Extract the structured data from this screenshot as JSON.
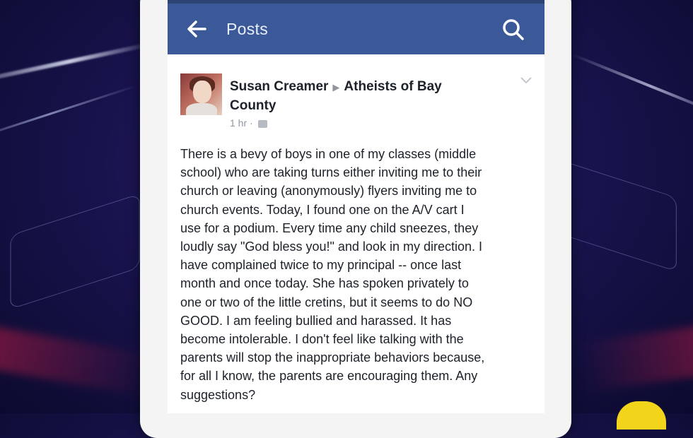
{
  "topbar": {
    "title": "Posts",
    "back_icon": "back-arrow-icon",
    "search_icon": "search-icon",
    "color": "#3b5998"
  },
  "post": {
    "author": "Susan Creamer",
    "group": "Atheists of Bay County",
    "timestamp": "1 hr",
    "privacy_icon": "audience-icon",
    "body": "There is a bevy of boys in one of my classes (middle\nschool) who are taking turns either inviting me to their\nchurch or leaving (anonymously) flyers inviting me to\nchurch events. Today, I found one on the A/V cart I\nuse for a podium. Every time any child sneezes, they\nloudly say \"God bless you!\" and look in my direction. I\nhave complained twice to my principal -- once last\nmonth and once today. She has spoken privately to\none or two of the little cretins, but it seems to do NO\nGOOD. I am feeling bullied and harassed. It has\nbecome intolerable. I don't feel like talking with the\nparents will stop the inappropriate behaviors because,\nfor all I know, the parents are encouraging them. Any\nsuggestions?"
  }
}
